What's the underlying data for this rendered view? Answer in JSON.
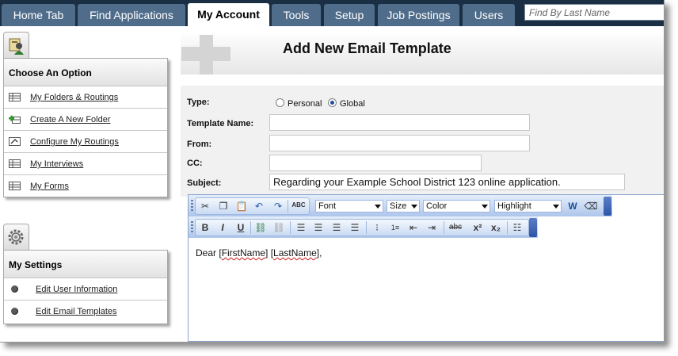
{
  "nav": {
    "tabs": [
      {
        "label": "Home Tab"
      },
      {
        "label": "Find Applications"
      },
      {
        "label": "My Account"
      },
      {
        "label": "Tools"
      },
      {
        "label": "Setup"
      },
      {
        "label": "Job Postings"
      },
      {
        "label": "Users"
      }
    ],
    "active_tab": "My Account",
    "search_placeholder": "Find By Last Name"
  },
  "sidebar": {
    "options_title": "Choose An Option",
    "options": [
      {
        "label": "My Folders & Routings",
        "icon": "folders-icon"
      },
      {
        "label": "Create A New Folder",
        "icon": "new-folder-icon"
      },
      {
        "label": "Configure My Routings",
        "icon": "routing-icon"
      },
      {
        "label": "My Interviews",
        "icon": "interviews-icon"
      },
      {
        "label": "My Forms",
        "icon": "forms-icon"
      }
    ],
    "settings_title": "My Settings",
    "settings": [
      {
        "label": "Edit User Information"
      },
      {
        "label": "Edit Email Templates"
      }
    ]
  },
  "main": {
    "title": "Add New Email Template",
    "form": {
      "type_label": "Type:",
      "type_options": [
        "Personal",
        "Global"
      ],
      "type_selected": "Global",
      "name_label": "Template Name:",
      "name_value": "",
      "from_label": "From:",
      "from_value": "",
      "cc_label": "CC:",
      "cc_value": "",
      "subject_label": "Subject:",
      "subject_value": "Regarding your Example School District 123 online application."
    },
    "editor": {
      "font_select": "Font",
      "size_select": "Size",
      "color_select": "Color",
      "highlight_select": "Highlight",
      "body_prefix": "Dear [",
      "token_first": "FirstName",
      "body_mid": "] [",
      "token_last": "LastName",
      "body_suffix": "],"
    }
  },
  "colors": {
    "nav_bg": "#1a2e44",
    "tab_bg": "#4f6d8a",
    "toolbar_blue": "#aec6ec"
  }
}
